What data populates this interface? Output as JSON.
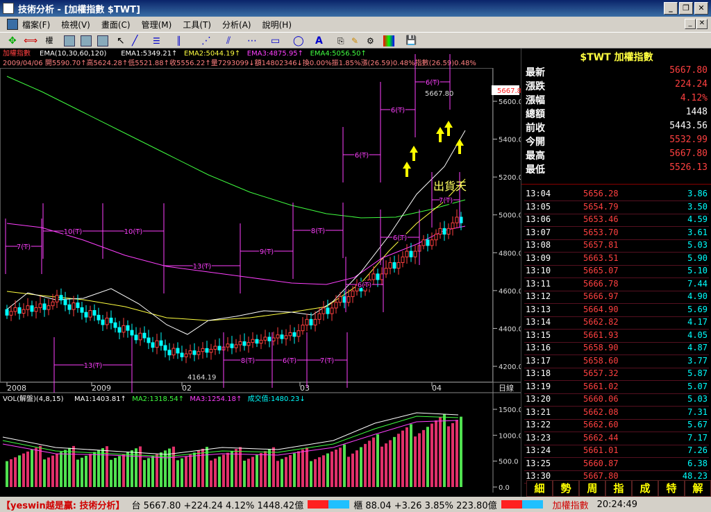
{
  "window": {
    "title": "技術分析 - [加權指數 $TWT]"
  },
  "menu": [
    "檔案(F)",
    "檢視(V)",
    "畫面(C)",
    "管理(M)",
    "工具(T)",
    "分析(A)",
    "說明(H)"
  ],
  "toolbar": {
    "period_label": "權"
  },
  "chart": {
    "ema_line": [
      {
        "text": "加權指數",
        "color": "#ff4040"
      },
      {
        "text": "EMA(10,30,60,120)",
        "color": "#ffffff"
      },
      {
        "text": "EMA1:5349.21↑",
        "color": "#ffffff"
      },
      {
        "text": "EMA2:5044.19↑",
        "color": "#ffff40"
      },
      {
        "text": "EMA3:4875.95↑",
        "color": "#ff40ff"
      },
      {
        "text": "EMA4:5056.50↑",
        "color": "#40ff40"
      }
    ],
    "info_line": "2009/04/06 開5590.70↑高5624.28↑低5521.88↑收5556.22↑量7293099↓額14802346↓換0.00%振1.85%漲(26.59)0.48%指數(26.59)0.48%",
    "price_ticks": [
      "5600.0",
      "5400.0",
      "5200.0",
      "5000.0",
      "4800.0",
      "4600.0",
      "4400.0",
      "4200.0"
    ],
    "current_price_tag": "5667.8",
    "peak_label": "5667.80",
    "low_label": "4164.19",
    "annotation": "出貨天",
    "date_ticks": [
      "2008",
      "2009",
      "02",
      "03",
      "04"
    ],
    "date_axis_label": "日線",
    "vol_line": [
      {
        "text": "VOL(解盤)(4,8,15)",
        "color": "#ffffff"
      },
      {
        "text": "MA1:1403.81↑",
        "color": "#ffffff"
      },
      {
        "text": "MA2:1318.54↑",
        "color": "#40ff40"
      },
      {
        "text": "MA3:1254.18↑",
        "color": "#ff40ff"
      },
      {
        "text": "成交值:1480.23↓",
        "color": "#00ffff"
      }
    ],
    "vol_ticks": [
      "1500.0",
      "1000.0",
      "500.0",
      "0.0"
    ],
    "cycle_labels": [
      "7(T)",
      "10(T)",
      "10(T)",
      "13(T)",
      "9(T)",
      "8(T)",
      "6(T)",
      "6(T)",
      "6(T)",
      "7(T)",
      "6(T)",
      "6(T)",
      "13(T)",
      "8(T)",
      "6(T)",
      "7(T)"
    ]
  },
  "quote": {
    "header": "$TWT 加權指數",
    "rows": [
      {
        "label": "最新",
        "value": "5667.80",
        "color": "#ff4040"
      },
      {
        "label": "漲跌",
        "value": "224.24",
        "color": "#ff4040"
      },
      {
        "label": "漲幅",
        "value": "4.12%",
        "color": "#ff4040"
      },
      {
        "label": "總額",
        "value": "1448",
        "color": "#ffffff"
      },
      {
        "label": "前收",
        "value": "5443.56",
        "color": "#ffffff"
      },
      {
        "label": "今開",
        "value": "5532.99",
        "color": "#ff4040"
      },
      {
        "label": "最高",
        "value": "5667.80",
        "color": "#ff4040"
      },
      {
        "label": "最低",
        "value": "5526.13",
        "color": "#ff4040"
      }
    ]
  },
  "ticks": [
    {
      "time": "13:04",
      "price": "5656.28",
      "vol": "3.86"
    },
    {
      "time": "13:05",
      "price": "5654.79",
      "vol": "3.50"
    },
    {
      "time": "13:06",
      "price": "5653.46",
      "vol": "4.59"
    },
    {
      "time": "13:07",
      "price": "5653.70",
      "vol": "3.61"
    },
    {
      "time": "13:08",
      "price": "5657.81",
      "vol": "5.03"
    },
    {
      "time": "13:09",
      "price": "5663.51",
      "vol": "5.90"
    },
    {
      "time": "13:10",
      "price": "5665.07",
      "vol": "5.10"
    },
    {
      "time": "13:11",
      "price": "5666.78",
      "vol": "7.44"
    },
    {
      "time": "13:12",
      "price": "5666.97",
      "vol": "4.90"
    },
    {
      "time": "13:13",
      "price": "5664.90",
      "vol": "5.69"
    },
    {
      "time": "13:14",
      "price": "5662.82",
      "vol": "4.17"
    },
    {
      "time": "13:15",
      "price": "5661.93",
      "vol": "4.05"
    },
    {
      "time": "13:16",
      "price": "5658.90",
      "vol": "4.87"
    },
    {
      "time": "13:17",
      "price": "5658.60",
      "vol": "3.77"
    },
    {
      "time": "13:18",
      "price": "5657.32",
      "vol": "5.87"
    },
    {
      "time": "13:19",
      "price": "5661.02",
      "vol": "5.07"
    },
    {
      "time": "13:20",
      "price": "5660.06",
      "vol": "5.03"
    },
    {
      "time": "13:21",
      "price": "5662.08",
      "vol": "7.31"
    },
    {
      "time": "13:22",
      "price": "5662.60",
      "vol": "5.67"
    },
    {
      "time": "13:23",
      "price": "5662.44",
      "vol": "7.17"
    },
    {
      "time": "13:24",
      "price": "5661.01",
      "vol": "7.26"
    },
    {
      "time": "13:25",
      "price": "5660.87",
      "vol": "6.38"
    },
    {
      "time": "13:30",
      "price": "5667.80",
      "vol": "48.23"
    }
  ],
  "tabs": [
    "細",
    "勢",
    "周",
    "指",
    "成",
    "特",
    "解"
  ],
  "status": {
    "brand": "【yeswin越是贏: 技術分析】",
    "taiex": "台 5667.80 +224.24 4.12% 1448.42億",
    "otc": "櫃 88.04 +3.26 3.85% 223.80億",
    "symbol": "加權指數",
    "clock": "20:24:49"
  },
  "colors": {
    "up": "#ff4040",
    "down": "#00ffff",
    "ema1": "#ffffff",
    "ema2": "#ffff40",
    "ema3": "#ff40ff",
    "ema4": "#40ff40"
  }
}
